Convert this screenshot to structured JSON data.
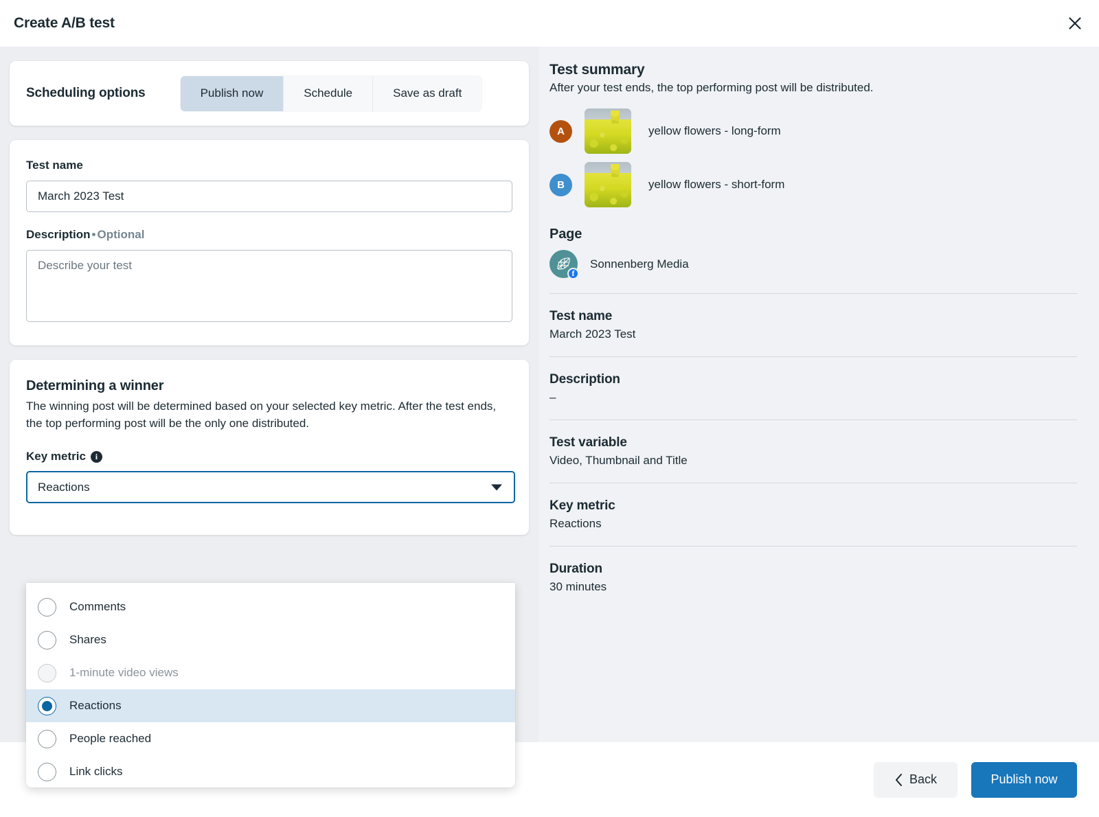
{
  "header": {
    "title": "Create A/B test",
    "close_icon": "close-icon"
  },
  "scheduling": {
    "label": "Scheduling options",
    "options": [
      {
        "label": "Publish now",
        "selected": true
      },
      {
        "label": "Schedule",
        "selected": false
      },
      {
        "label": "Save as draft",
        "selected": false
      }
    ]
  },
  "test_name": {
    "label": "Test name",
    "value": "March 2023 Test",
    "placeholder": "Test name"
  },
  "description": {
    "label": "Description",
    "separator": "•",
    "optional_label": "Optional",
    "value": "",
    "placeholder": "Describe your test"
  },
  "winner": {
    "title": "Determining a winner",
    "description": "The winning post will be determined based on your selected key metric. After the test ends, the top performing post will be the only one distributed.",
    "key_metric_label": "Key metric",
    "info_icon": "info-icon",
    "selected_value": "Reactions",
    "caret_icon": "chevron-down-icon",
    "options": [
      {
        "label": "Comments",
        "selected": false,
        "disabled": false
      },
      {
        "label": "Shares",
        "selected": false,
        "disabled": false
      },
      {
        "label": "1-minute video views",
        "selected": false,
        "disabled": true
      },
      {
        "label": "Reactions",
        "selected": true,
        "disabled": false
      },
      {
        "label": "People reached",
        "selected": false,
        "disabled": false
      },
      {
        "label": "Link clicks",
        "selected": false,
        "disabled": false
      }
    ]
  },
  "summary": {
    "title": "Test summary",
    "subtitle": "After your test ends, the top performing post will be distributed.",
    "variants": [
      {
        "badge": "A",
        "badge_color": "#b4510f",
        "title": "yellow flowers - long-form"
      },
      {
        "badge": "B",
        "badge_color": "#3f8ecd",
        "title": "yellow flowers - short-form"
      }
    ],
    "page_heading": "Page",
    "page_name": "Sonnenberg Media",
    "page_avatar_icon": "page-avatar-icon",
    "page_platform_icon": "facebook-badge-icon",
    "fields": [
      {
        "key": "Test name",
        "value": "March 2023 Test"
      },
      {
        "key": "Description",
        "value": "–"
      },
      {
        "key": "Test variable",
        "value": "Video, Thumbnail and Title"
      },
      {
        "key": "Key metric",
        "value": "Reactions"
      },
      {
        "key": "Duration",
        "value": "30 minutes"
      }
    ]
  },
  "footer": {
    "back_label": "Back",
    "back_icon": "chevron-left-icon",
    "publish_label": "Publish now"
  },
  "colors": {
    "accent_blue": "#1876ba",
    "focus_blue": "#0a66a2",
    "selected_row": "#d9e7f3",
    "segment_active": "#ccd9e6",
    "panel_grey": "#f0f2f5",
    "left_grey": "#eceef1",
    "text_dark": "#1c2b33",
    "text_muted": "#768692"
  }
}
